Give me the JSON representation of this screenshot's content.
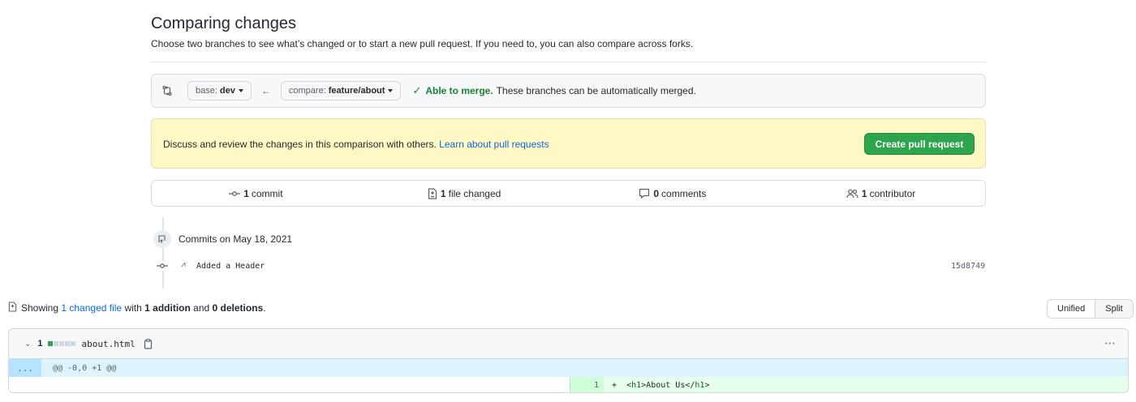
{
  "header": {
    "title": "Comparing changes",
    "subtitle": "Choose two branches to see what’s changed or to start a new pull request. If you need to, you can also compare across forks."
  },
  "range": {
    "base_prefix": "base:",
    "base_branch": "dev",
    "compare_prefix": "compare:",
    "compare_branch": "feature/about",
    "arrow": "←",
    "merge_able": "Able to merge.",
    "merge_text": "These branches can be automatically merged."
  },
  "flash": {
    "text": "Discuss and review the changes in this comparison with others.",
    "link": "Learn about pull requests",
    "create_button": "Create pull request"
  },
  "summary": {
    "commits_count": "1",
    "commits_label": "commit",
    "files_count": "1",
    "files_label": "file changed",
    "comments_count": "0",
    "comments_label": "comments",
    "contributors_count": "1",
    "contributors_label": "contributor"
  },
  "commits": {
    "group_label": "Commits on May 18, 2021",
    "items": [
      {
        "message": "Added a Header",
        "sha": "15d8749"
      }
    ]
  },
  "diff_summary": {
    "showing": "Showing",
    "changed_link": "1 changed file",
    "with": "with",
    "additions": "1 addition",
    "and": "and",
    "deletions": "0 deletions",
    "period": "."
  },
  "view_toggle": {
    "unified": "Unified",
    "split": "Split",
    "active": "Split"
  },
  "file": {
    "count": "1",
    "name": "about.html",
    "hunk_expand": "...",
    "hunk_header": "@@ -0,0 +1 @@",
    "lines": [
      {
        "new_num": "1",
        "sign": "+",
        "code_prefix": "<",
        "tag_open": "h1",
        "content": ">About Us</",
        "tag_close": "h1",
        "code_suffix": ">"
      }
    ]
  },
  "colors": {
    "accent_green": "#2da44e",
    "link_blue": "#0969da",
    "flash_yellow": "#fff8c5",
    "addition_bg": "#e6ffec",
    "hunk_bg": "#ddf4ff"
  }
}
